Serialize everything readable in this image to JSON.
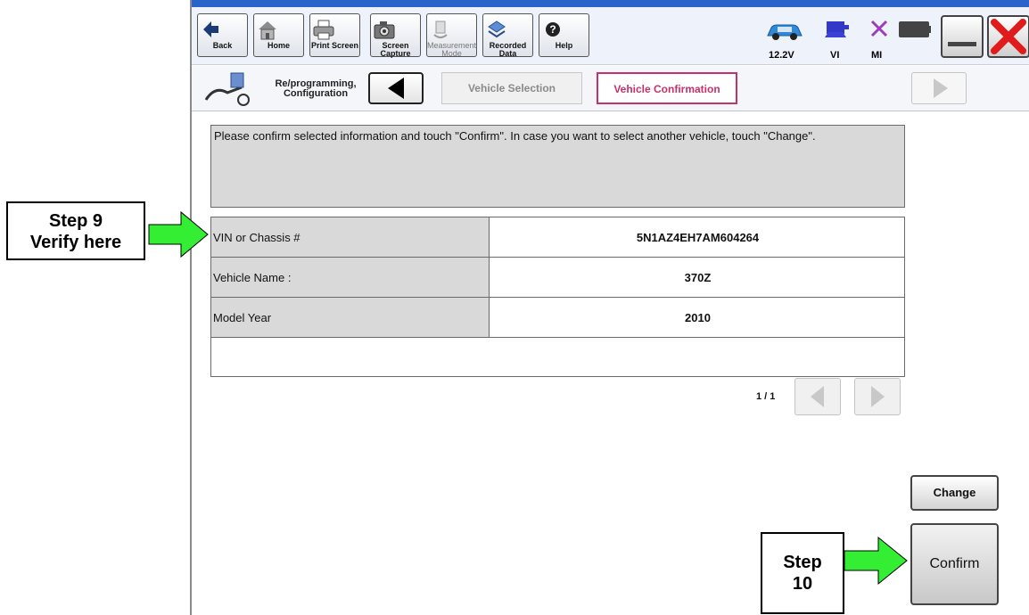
{
  "toolbar": {
    "buttons": [
      {
        "label": "Back",
        "icon": "back-arrow-icon"
      },
      {
        "label": "Home",
        "icon": "home-icon"
      },
      {
        "label": "Print Screen",
        "icon": "printer-icon"
      },
      {
        "label": "Screen\nCapture",
        "icon": "camera-icon"
      },
      {
        "label": "Measurement\nMode",
        "icon": "measurement-icon"
      },
      {
        "label": "Recorded\nData",
        "icon": "recorded-data-icon"
      },
      {
        "label": "Help",
        "icon": "help-icon"
      }
    ],
    "battery_voltage": "12.2V",
    "vi_label": "VI",
    "mi_label": "MI"
  },
  "breadcrumb": {
    "mode_label": "Re/programming,\nConfiguration",
    "steps": [
      {
        "label": "Vehicle Selection",
        "active": false
      },
      {
        "label": "Vehicle Confirmation",
        "active": true
      }
    ]
  },
  "message": "Please confirm selected information and touch \"Confirm\". In case you want to select another vehicle, touch \"Change\".",
  "vehicle_info": {
    "rows": [
      {
        "label": "VIN or Chassis #",
        "value": "5N1AZ4EH7AM604264"
      },
      {
        "label": "Vehicle Name :",
        "value": "370Z"
      },
      {
        "label": "Model Year",
        "value": "2010"
      }
    ]
  },
  "pager": {
    "text": "1 / 1"
  },
  "buttons": {
    "change": "Change",
    "confirm": "Confirm"
  },
  "annotations": {
    "step9": "Step 9\nVerify here",
    "step10": "Step\n10"
  },
  "colors": {
    "accent_active_tab": "#c4316b",
    "annotation_arrow": "#33ee33",
    "titlebar": "#2a63c9"
  }
}
